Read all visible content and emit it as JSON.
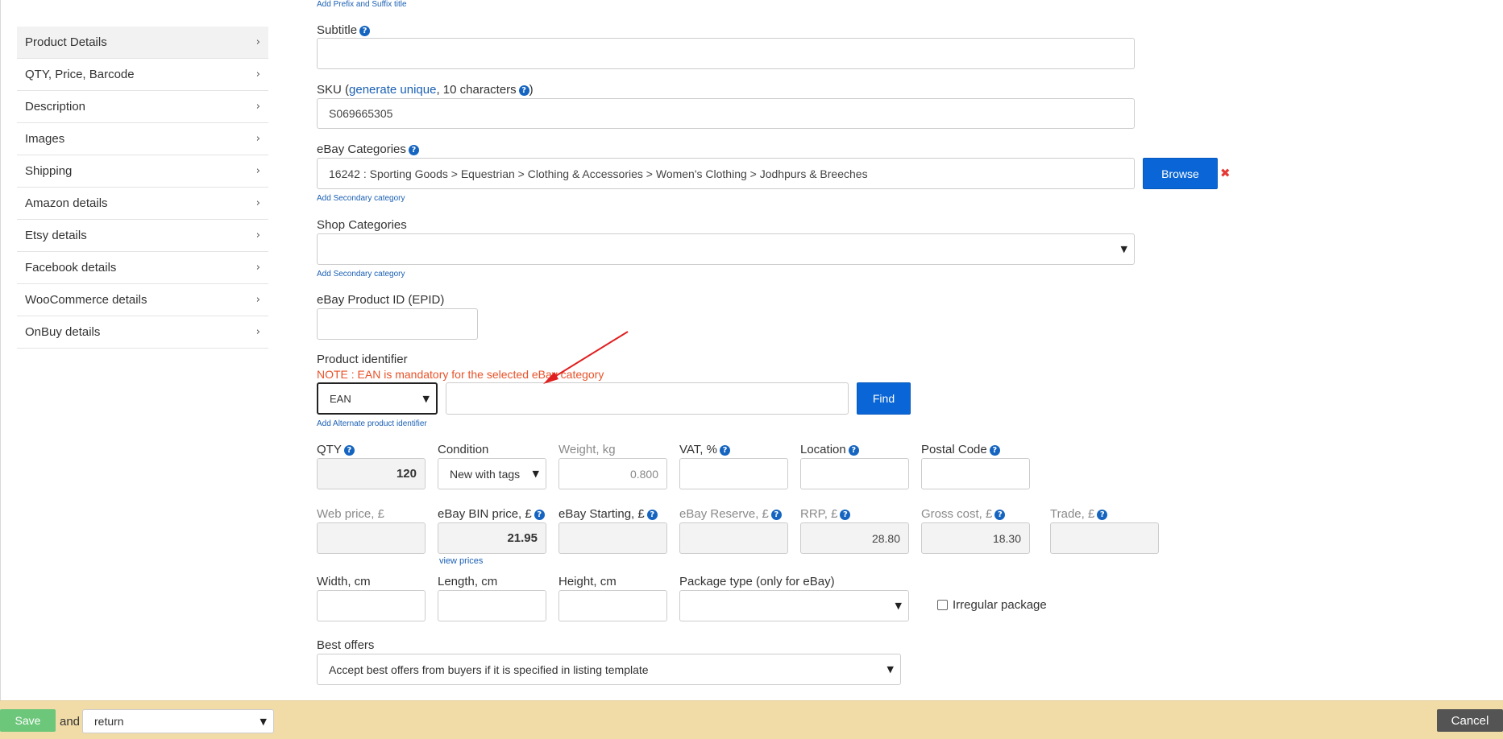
{
  "sidebar": {
    "items": [
      {
        "label": "Product Details"
      },
      {
        "label": "QTY, Price, Barcode"
      },
      {
        "label": "Description"
      },
      {
        "label": "Images"
      },
      {
        "label": "Shipping"
      },
      {
        "label": "Amazon details"
      },
      {
        "label": "Etsy details"
      },
      {
        "label": "Facebook details"
      },
      {
        "label": "WooCommerce details"
      },
      {
        "label": "OnBuy details"
      }
    ],
    "chevron": "›"
  },
  "form": {
    "prefix_suffix_link": "Add Prefix and Suffix title",
    "subtitle": {
      "label": "Subtitle",
      "value": ""
    },
    "sku": {
      "label_prefix": "SKU (",
      "generate_link": "generate unique",
      "label_suffix": ", 10 characters",
      "label_close": ")",
      "value": "S069665305"
    },
    "ebay_categories": {
      "label": "eBay Categories",
      "value": "16242 : Sporting Goods > Equestrian > Clothing & Accessories > Women's Clothing > Jodhpurs & Breeches",
      "browse_label": "Browse",
      "remove_icon": "✖",
      "secondary_link": "Add Secondary category"
    },
    "shop_categories": {
      "label": "Shop Categories",
      "value": "",
      "secondary_link": "Add Secondary category"
    },
    "epid": {
      "label": "eBay Product ID (EPID)",
      "value": ""
    },
    "product_identifier": {
      "label": "Product identifier",
      "note": "NOTE : EAN is mandatory for the selected eBay category",
      "type_value": "EAN",
      "value": "",
      "find_label": "Find",
      "alternate_link": "Add Alternate product identifier"
    },
    "row1": {
      "qty": {
        "label": "QTY",
        "value": "120"
      },
      "condition": {
        "label": "Condition",
        "value": "New with tags"
      },
      "weight": {
        "label": "Weight, kg",
        "value": "0.800"
      },
      "vat": {
        "label": "VAT, %",
        "value": ""
      },
      "location": {
        "label": "Location",
        "value": ""
      },
      "postal_code": {
        "label": "Postal Code",
        "value": ""
      }
    },
    "row2": {
      "web_price": {
        "label": "Web price, £",
        "value": ""
      },
      "ebay_bin": {
        "label": "eBay BIN price, £",
        "value": "21.95",
        "view_prices": "view prices"
      },
      "ebay_starting": {
        "label": "eBay Starting, £",
        "value": ""
      },
      "ebay_reserve": {
        "label": "eBay Reserve, £",
        "value": ""
      },
      "rrp": {
        "label": "RRP, £",
        "value": "28.80"
      },
      "gross_cost": {
        "label": "Gross cost, £",
        "value": "18.30"
      },
      "trade": {
        "label": "Trade, £",
        "value": ""
      }
    },
    "row3": {
      "width": {
        "label": "Width, cm",
        "value": ""
      },
      "length": {
        "label": "Length, cm",
        "value": ""
      },
      "height": {
        "label": "Height, cm",
        "value": ""
      },
      "package_type": {
        "label": "Package type (only for eBay)",
        "value": ""
      },
      "irregular": {
        "label": "Irregular package",
        "checked": false
      }
    },
    "best_offers": {
      "label": "Best offers",
      "value": "Accept best offers from buyers if it is specified in listing template"
    },
    "help_glyph": "?"
  },
  "bottom_bar": {
    "save_label": "Save",
    "and_label": "and",
    "after_save_value": "return",
    "cancel_label": "Cancel"
  },
  "colors": {
    "accent": "#0a66d6",
    "note": "#e8532a",
    "save": "#6cc77a",
    "bottom_bar": "#f1dca8",
    "arrow": "#e02020"
  }
}
